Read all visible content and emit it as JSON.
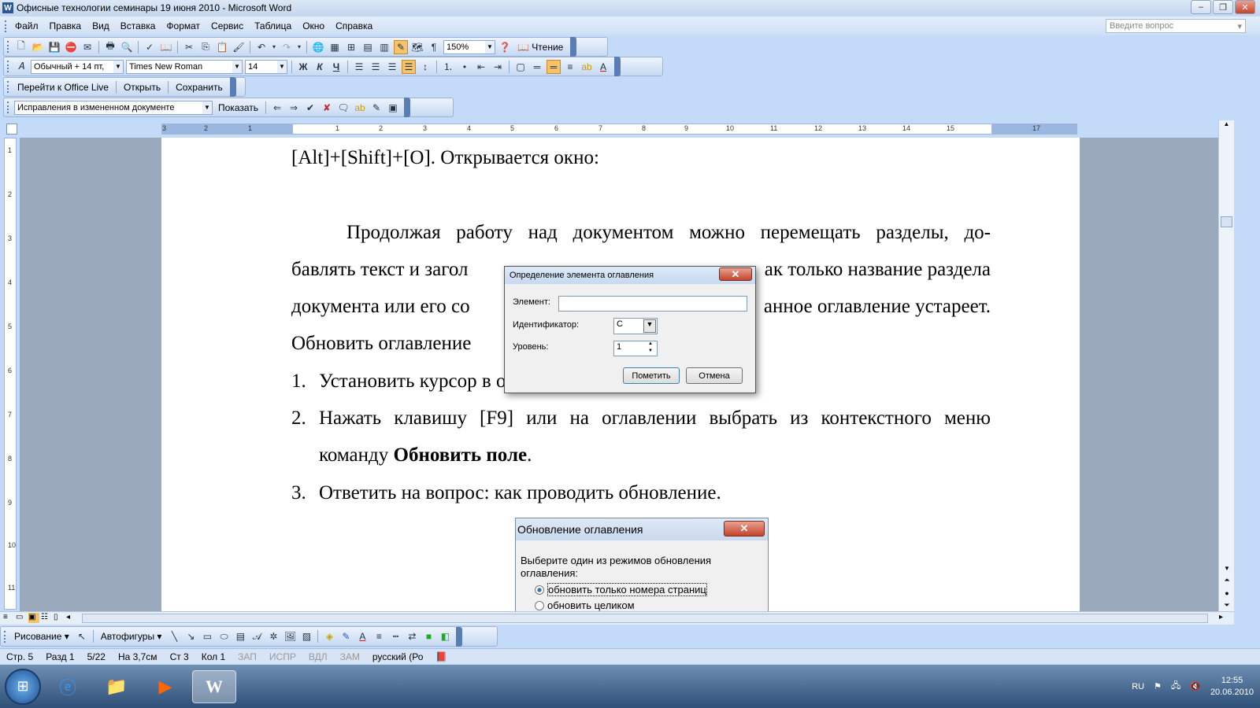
{
  "window": {
    "title": "Офисные технологии семинары 19 июня 2010 - Microsoft Word",
    "app_icon": "W"
  },
  "menu": [
    "Файл",
    "Правка",
    "Вид",
    "Вставка",
    "Формат",
    "Сервис",
    "Таблица",
    "Окно",
    "Справка"
  ],
  "ask_placeholder": "Введите вопрос",
  "toolbar_standard": {
    "zoom": "150%",
    "reading_label": "Чтение"
  },
  "toolbar_format": {
    "style": "Обычный + 14 пт,",
    "font": "Times New Roman",
    "size": "14",
    "bold": "Ж",
    "italic": "К",
    "underline": "Ч"
  },
  "toolbar_office_live": {
    "goto": "Перейти к Office Live",
    "open": "Открыть",
    "save": "Сохранить"
  },
  "toolbar_review": {
    "mode": "Исправления в измененном документе",
    "show": "Показать"
  },
  "ruler_numbers": [
    "3",
    "2",
    "1",
    "1",
    "2",
    "3",
    "4",
    "5",
    "6",
    "7",
    "8",
    "9",
    "10",
    "11",
    "12",
    "13",
    "14",
    "15",
    "17"
  ],
  "vruler_numbers": [
    "1",
    "2",
    "3",
    "4",
    "5",
    "6",
    "7",
    "8",
    "9",
    "10",
    "11"
  ],
  "document": {
    "line0": "[Alt]+[Shift]+[O]. Открывается окно:",
    "para_line1": [
      "Продолжая",
      "работу",
      "над",
      "документом",
      "можно",
      "перемещать",
      "разделы,",
      "до-"
    ],
    "para_line2_left": "бавлять текст и загол",
    "para_line2_right": "ак только название раздела",
    "para_line3_left": "документа или его со",
    "para_line3_right": "анное оглавление устареет.",
    "para_line4": "Обновить оглавление",
    "list": [
      {
        "num": "1.",
        "text": "Установить курсор в оглавление."
      },
      {
        "num": "2.",
        "text_words": [
          "Нажать",
          "клавишу",
          "[F9]",
          "или",
          "на",
          "оглавлении",
          "выбрать",
          "из",
          "контекстного",
          "меню"
        ],
        "text2_pre": "команду ",
        "text2_bold": "Обновить поле",
        "text2_post": "."
      },
      {
        "num": "3.",
        "text": "Ответить на вопрос: как проводить обновление."
      }
    ]
  },
  "dialog_toc": {
    "title": "Определение элемента оглавления",
    "element_label": "Элемент:",
    "element_value": "",
    "id_label": "Идентификатор:",
    "id_value": "C",
    "level_label": "Уровень:",
    "level_value": "1",
    "ok": "Пометить",
    "cancel": "Отмена"
  },
  "dialog_update": {
    "title": "Обновление оглавления",
    "prompt": "Выберите один из режимов обновления оглавления:",
    "option1": "обновить только номера страниц",
    "option2": "обновить целиком"
  },
  "drawbar": {
    "draw": "Рисование",
    "autoshapes": "Автофигуры"
  },
  "status": {
    "page": "Стр. 5",
    "section": "Разд 1",
    "pages": "5/22",
    "pos": "На 3,7см",
    "line": "Ст 3",
    "col": "Кол 1",
    "rec": "ЗАП",
    "trk": "ИСПР",
    "ext": "ВДЛ",
    "ovr": "ЗАМ",
    "lang": "русский (Ро"
  },
  "taskbar": {
    "lang": "RU",
    "time": "12:55",
    "date": "20.06.2010"
  }
}
